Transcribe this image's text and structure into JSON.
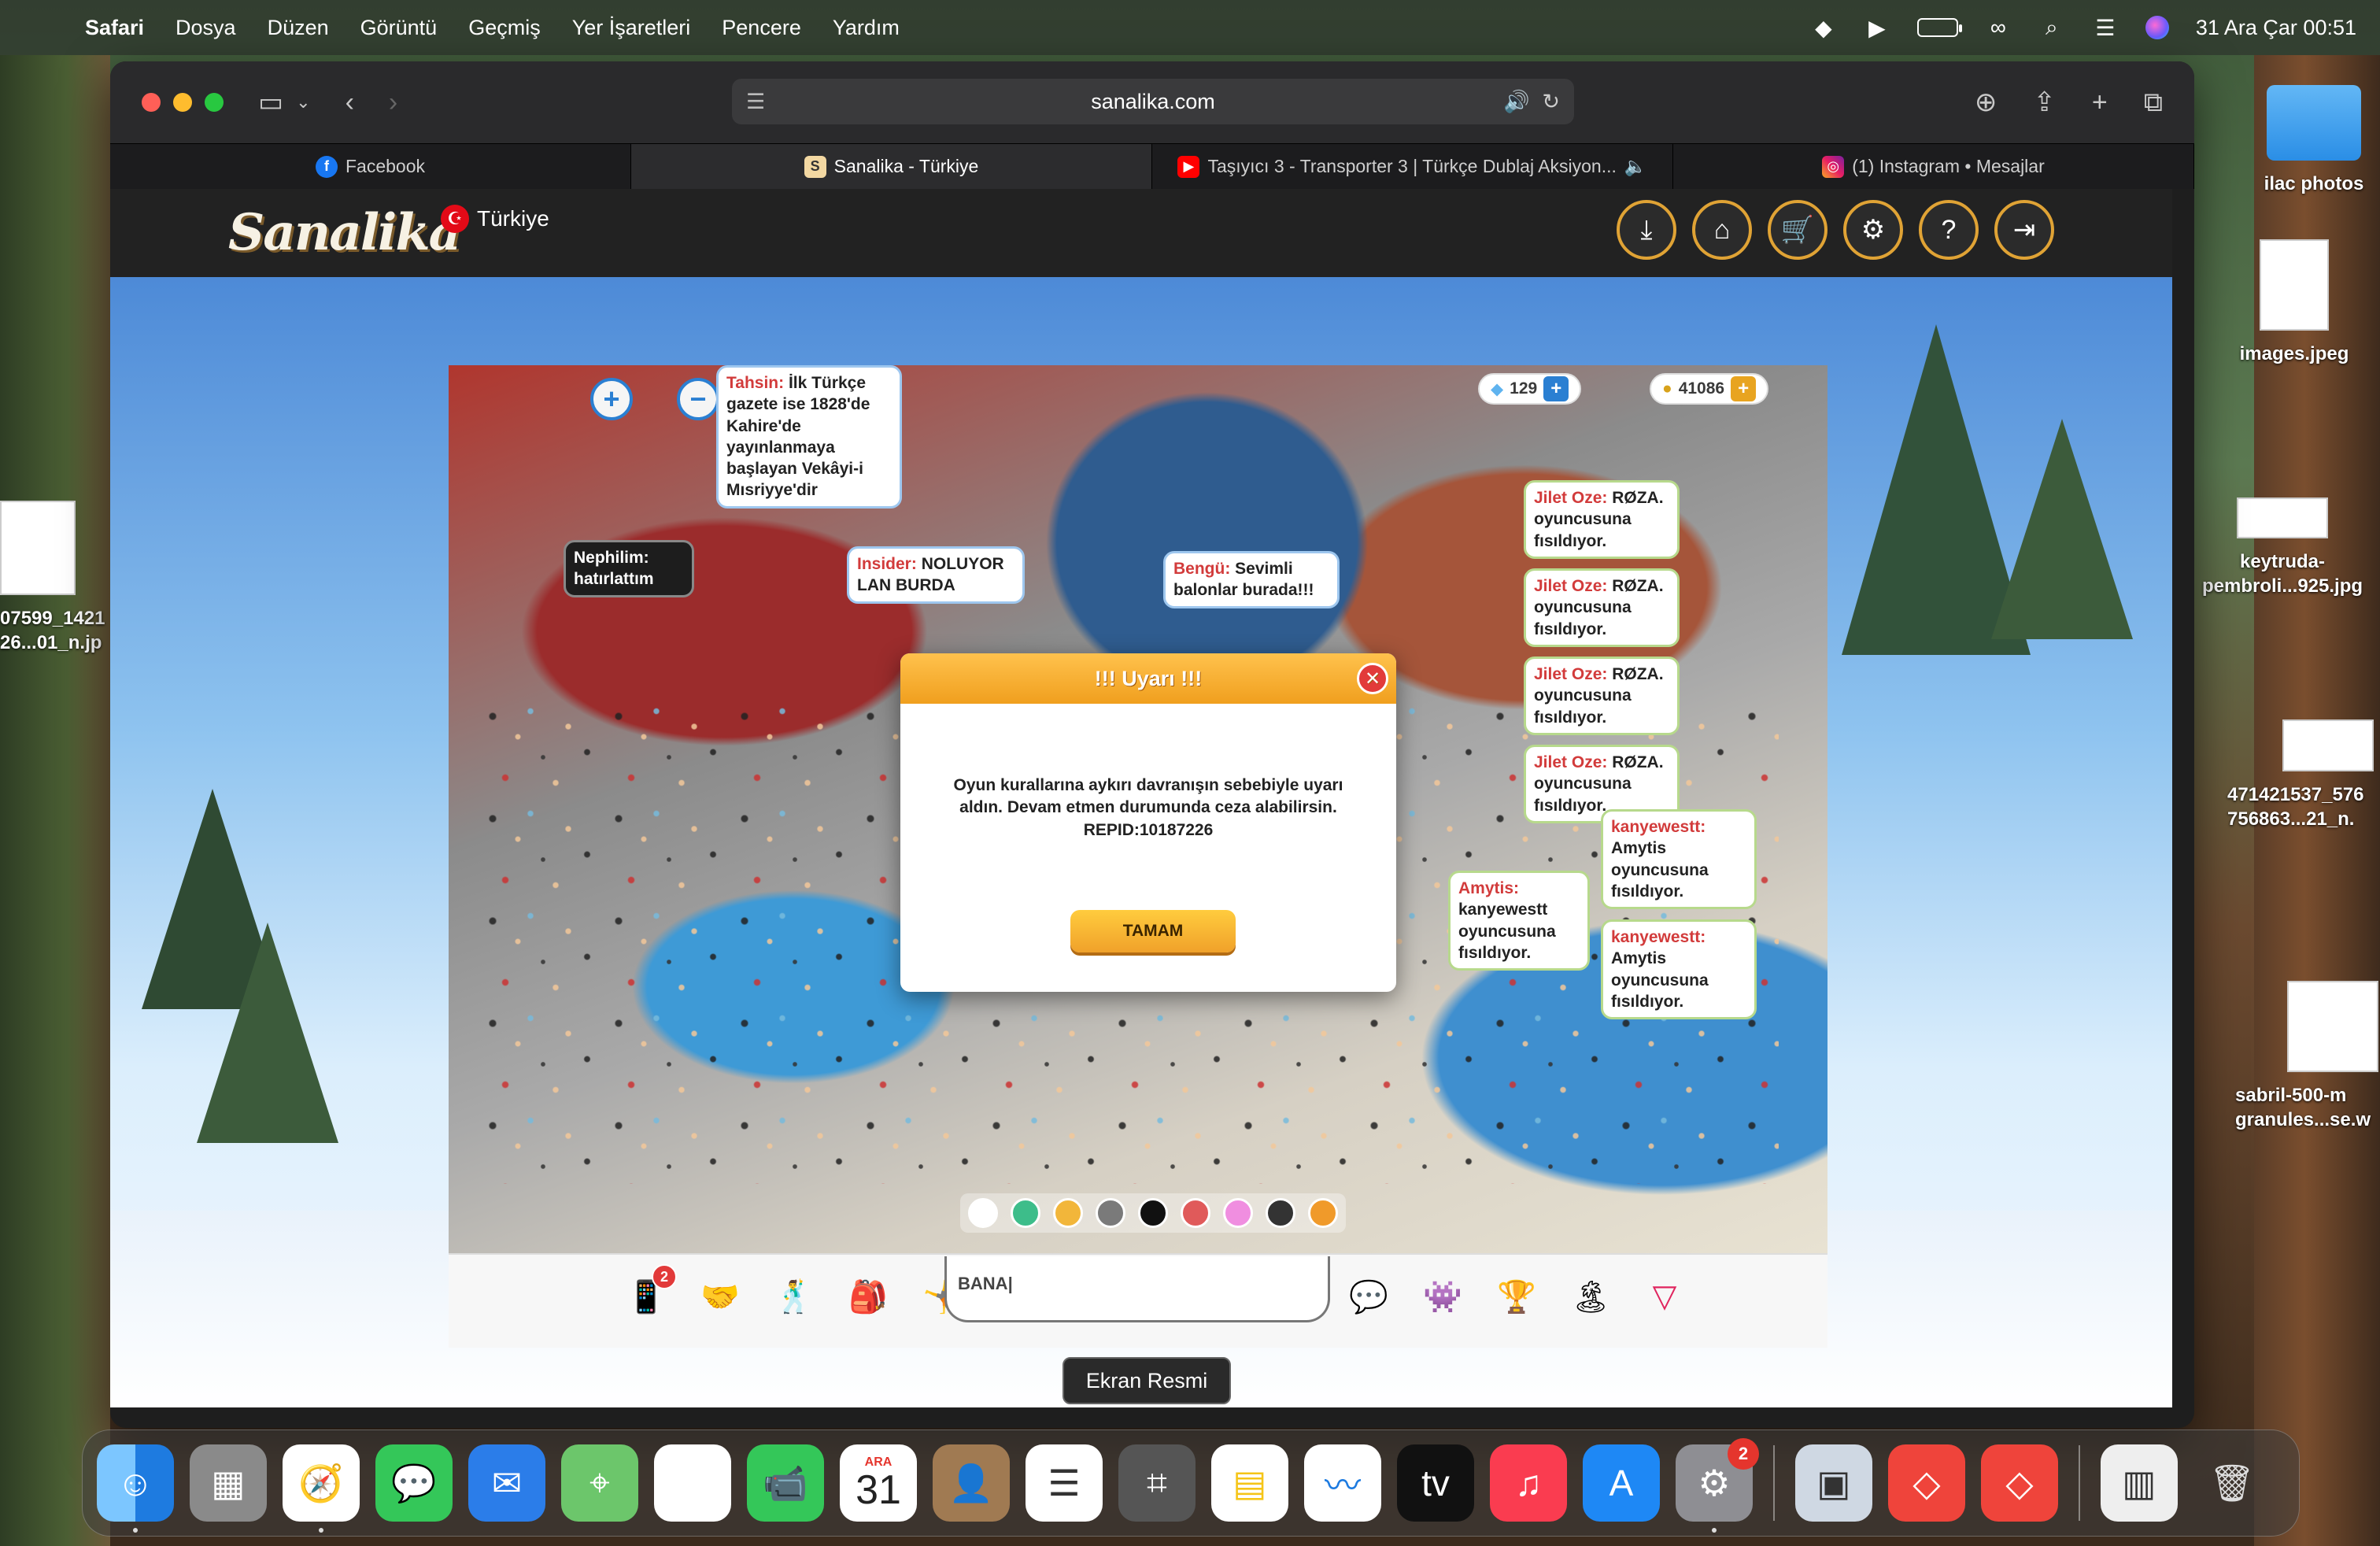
{
  "menubar": {
    "app": "Safari",
    "items": [
      "Dosya",
      "Düzen",
      "Görüntü",
      "Geçmiş",
      "Yer İşaretleri",
      "Pencere",
      "Yardım"
    ],
    "clock": "31 Ara Çar  00:51"
  },
  "browser": {
    "url": "sanalika.com",
    "tabs": [
      {
        "label": "Facebook",
        "icon": "facebook-icon"
      },
      {
        "label": "Sanalika - Türkiye",
        "icon": "sanalika-icon",
        "active": true
      },
      {
        "label": "Taşıyıcı 3 - Transporter 3 | Türkçe Dublaj Aksiyon...",
        "icon": "youtube-icon"
      },
      {
        "label": "(1) Instagram • Mesajlar",
        "icon": "instagram-icon"
      }
    ]
  },
  "site": {
    "logo": "Sanalika",
    "country": "Türkiye"
  },
  "game": {
    "diamonds": "129",
    "coins": "41086",
    "bubbles": [
      {
        "who": "Tahsin:",
        "text": "İlk Türkçe gazete ise 1828'de Kahire'de yayınlanmaya başlayan Vekâyi-i Mısriyye'dir"
      },
      {
        "who": "Nephilim:",
        "text": "hatırlattım"
      },
      {
        "who": "Insider:",
        "text": "NOLUYOR LAN BURDA"
      },
      {
        "who": "Bengü:",
        "text": "Sevimli balonlar burada!!!"
      }
    ],
    "whispers": [
      {
        "who": "Jilet Oze:",
        "text": "RØZA. oyuncusuna fısıldıyor."
      },
      {
        "who": "Jilet Oze:",
        "text": "RØZA. oyuncusuna fısıldıyor."
      },
      {
        "who": "Jilet Oze:",
        "text": "RØZA. oyuncusuna fısıldıyor."
      },
      {
        "who": "Jilet Oze:",
        "text": "RØZA. oyuncusuna fısıldıyor."
      },
      {
        "who": "kanyewestt:",
        "text": "Amytis oyuncusuna fısıldıyor."
      },
      {
        "who": "Amytis:",
        "text": "kanyewestt oyuncusuna fısıldıyor."
      },
      {
        "who": "kanyewestt:",
        "text": "Amytis oyuncusuna fısıldıyor."
      }
    ],
    "dialog": {
      "title": "!!! Uyarı !!!",
      "message": "Oyun kurallarına aykırı davranışın sebebiyle uyarı aldın. Devam etmen durumunda ceza alabilirsin. REPID:10187226",
      "button": "TAMAM"
    },
    "chat_input": "BANA",
    "phone_badge": "2",
    "palette": [
      "#ffffff",
      "#3dbd8a",
      "#f2b63a",
      "#7a7a7a",
      "#111111",
      "#e05a5a",
      "#f08ee0",
      "#333333",
      "#f09a2a"
    ]
  },
  "tooltip": "Ekran Resmi",
  "desktop": {
    "icons": [
      {
        "label": "ilac photos"
      },
      {
        "label": "images.jpeg"
      },
      {
        "label": "keytruda-pembroli...925.jpg"
      },
      {
        "label": "471421537_576 756863...21_n."
      },
      {
        "label": "sabril-500-m granules...se.w"
      },
      {
        "label": "07599_1421 26...01_n.jp"
      }
    ]
  },
  "dock": {
    "calendar_month": "ARA",
    "calendar_day": "31",
    "settings_badge": "2",
    "apps": [
      "finder-icon",
      "launchpad-icon",
      "safari-icon",
      "messages-icon",
      "mail-icon",
      "maps-icon",
      "photos-icon",
      "facetime-icon",
      "calendar-icon",
      "contacts-icon",
      "reminders-icon",
      "screenshot-icon",
      "notes-icon",
      "freeform-icon",
      "appletv-icon",
      "music-icon",
      "appstore-icon",
      "settings-icon",
      "preview-icon",
      "anydesk-icon",
      "anydesk-icon",
      "document-icon",
      "trash-icon"
    ]
  },
  "colors": {
    "accent_orange": "#f09f1e",
    "site_icon_ring": "#e0a335",
    "whisper_border": "#b7d98c"
  }
}
